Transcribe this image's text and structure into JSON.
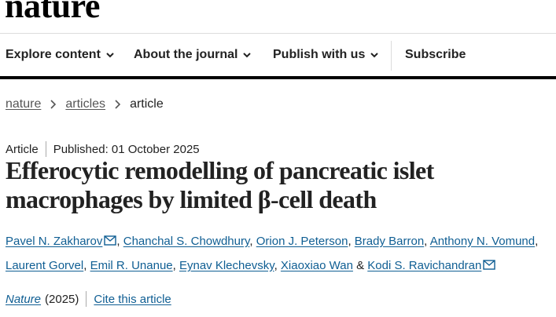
{
  "brand": {
    "logo_text": "nature"
  },
  "nav": {
    "items": [
      {
        "label": "Explore content"
      },
      {
        "label": "About the journal"
      },
      {
        "label": "Publish with us"
      }
    ],
    "subscribe_label": "Subscribe"
  },
  "breadcrumb": {
    "items": [
      {
        "label": "nature"
      },
      {
        "label": "articles"
      }
    ],
    "current": "article"
  },
  "article": {
    "type": "Article",
    "published": "Published: 01 October 2025",
    "title": "Efferocytic remodelling of pancreatic islet macrophages by limited β-cell death",
    "authors": [
      "Pavel N. Zakharov",
      "Chanchal S. Chowdhury",
      "Orion J. Peterson",
      "Brady Barron",
      "Anthony N. Vomund",
      "Laurent Gorvel",
      "Emil R. Unanue",
      "Eynav Klechevsky",
      "Xiaoxiao Wan",
      "Kodi S. Ravichandran"
    ],
    "journal": "Nature",
    "year": "(2025)",
    "cite_label": "Cite this article"
  },
  "colors": {
    "link": "#0f5e93",
    "text": "#222222",
    "rule": "#000000"
  }
}
